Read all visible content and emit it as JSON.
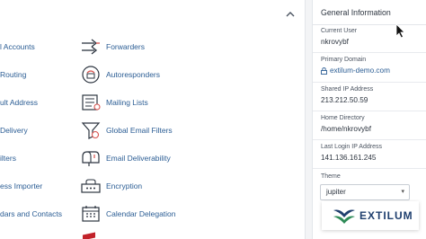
{
  "email": {
    "left_items": [
      "l Accounts",
      "Routing",
      "ult Address",
      "Delivery",
      "ilters",
      "ess Importer",
      "dars and Contacts"
    ],
    "right_items": [
      {
        "label": "Forwarders",
        "icon": "forwarders-icon"
      },
      {
        "label": "Autoresponders",
        "icon": "autoresponders-icon"
      },
      {
        "label": "Mailing Lists",
        "icon": "mailing-lists-icon"
      },
      {
        "label": "Global Email Filters",
        "icon": "email-filters-icon"
      },
      {
        "label": "Email Deliverability",
        "icon": "mailbox-icon"
      },
      {
        "label": "Encryption",
        "icon": "encryption-icon"
      },
      {
        "label": "Calendar Delegation",
        "icon": "calendar-icon"
      }
    ]
  },
  "info": {
    "title": "General Information",
    "current_user_label": "Current User",
    "current_user": "nkrovybf",
    "primary_domain_label": "Primary Domain",
    "primary_domain": "extilum-demo.com",
    "shared_ip_label": "Shared IP Address",
    "shared_ip": "213.212.50.59",
    "home_dir_label": "Home Directory",
    "home_dir": "/home/nkrovybf",
    "last_login_label": "Last Login IP Address",
    "last_login": "141.136.161.245",
    "theme_label": "Theme",
    "theme_value": "jupiter"
  },
  "logo": {
    "text": "EXTILUM"
  },
  "colors": {
    "link": "#2b5d94",
    "accent_red": "#c2222a",
    "logo_green": "#2e8b57",
    "logo_blue": "#1f3f6e"
  }
}
